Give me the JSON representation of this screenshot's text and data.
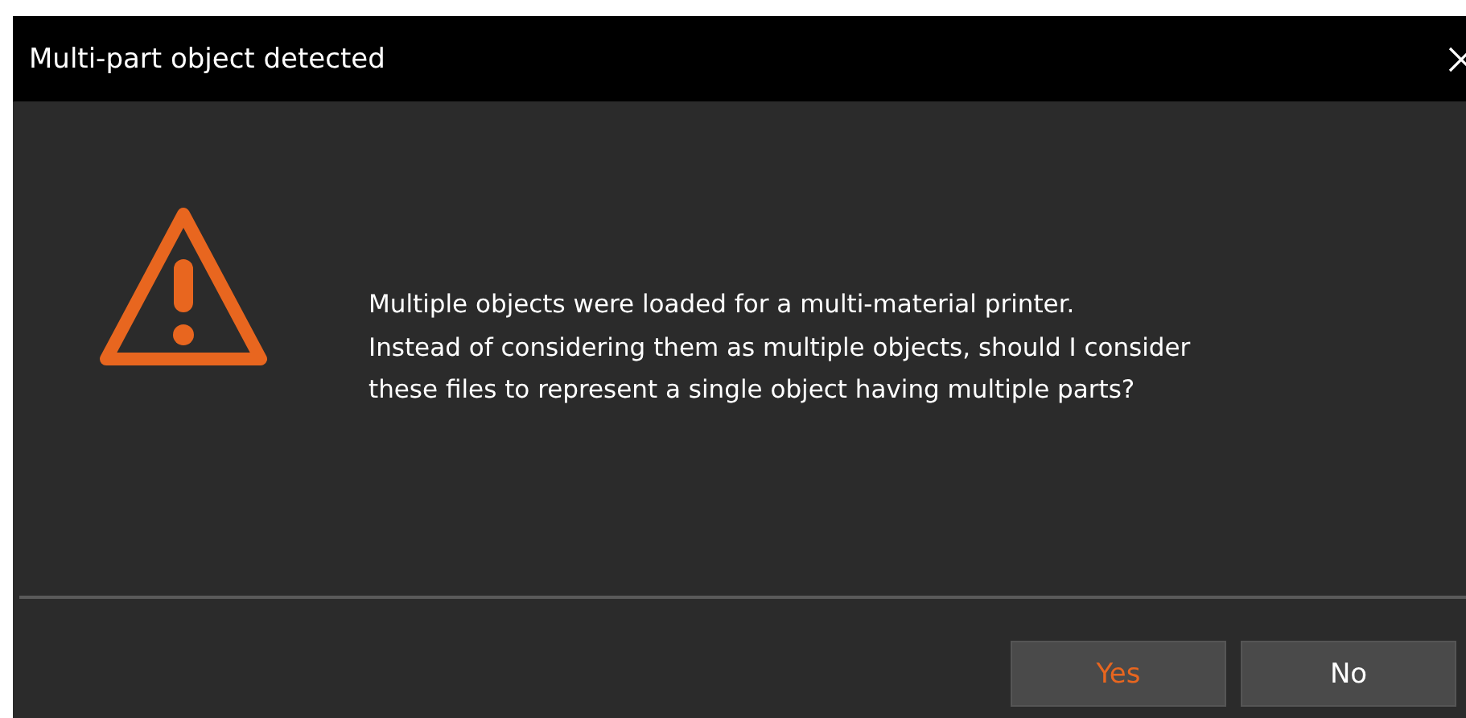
{
  "window": {
    "title": "Multi-part object detected"
  },
  "message": [
    "Multiple objects were loaded for a multi-material printer.",
    "Instead of considering them as multiple objects, should I consider",
    "these files to represent a single object having multiple parts?"
  ],
  "buttons": [
    {
      "label": "Yes",
      "default": true
    },
    {
      "label": "No",
      "default": false
    }
  ]
}
